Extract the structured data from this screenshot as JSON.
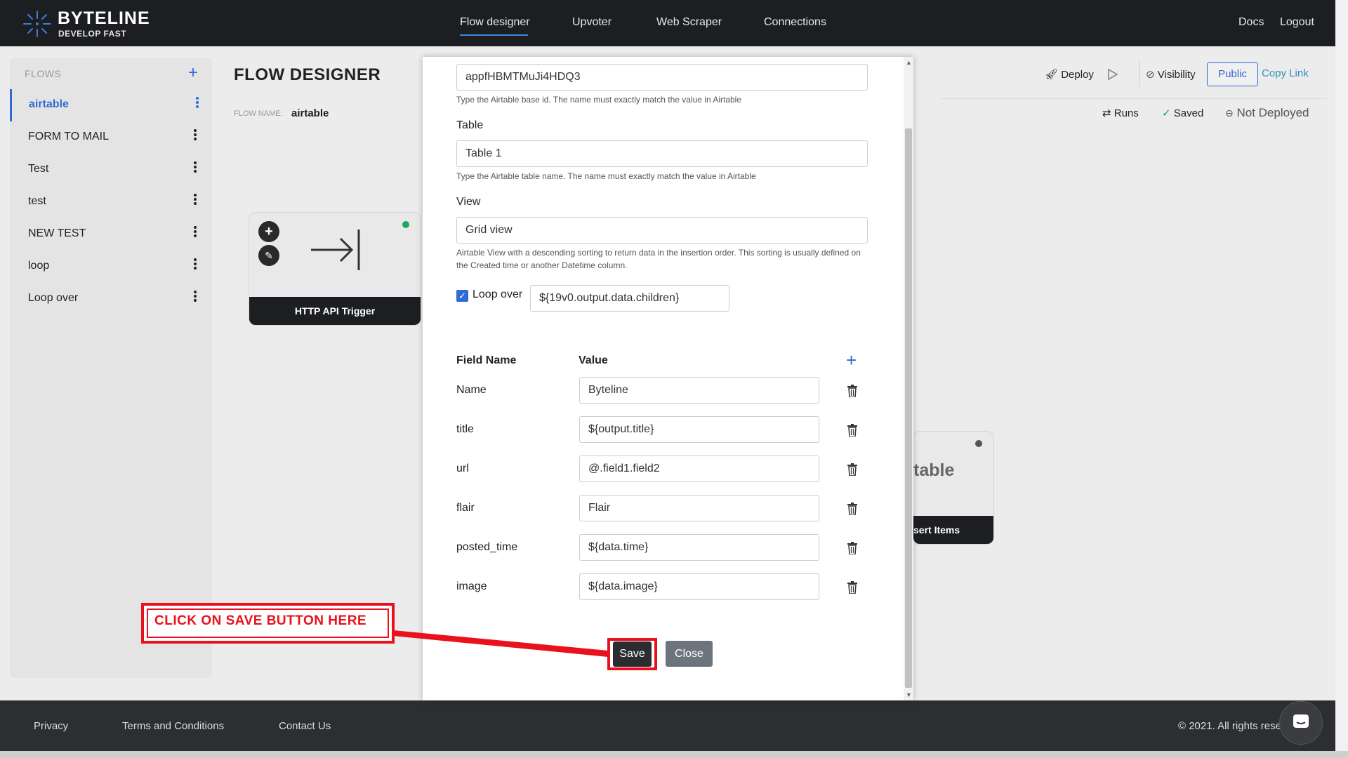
{
  "brand": {
    "name": "BYTELINE",
    "tagline": "DEVELOP FAST"
  },
  "nav": {
    "items": [
      {
        "label": "Flow designer",
        "active": true
      },
      {
        "label": "Upvoter"
      },
      {
        "label": "Web Scraper"
      },
      {
        "label": "Connections"
      }
    ],
    "right": [
      "Docs",
      "Logout"
    ]
  },
  "sidebar": {
    "header": "FLOWS",
    "add_icon": "+",
    "items": [
      {
        "label": "airtable",
        "active": true
      },
      {
        "label": "FORM TO MAIL"
      },
      {
        "label": "Test"
      },
      {
        "label": "test"
      },
      {
        "label": "NEW TEST"
      },
      {
        "label": "loop"
      },
      {
        "label": "Loop over"
      }
    ]
  },
  "main": {
    "title": "FLOW DESIGNER",
    "flow_name_key": "FLOW NAME:",
    "flow_name": "airtable",
    "toolbar": {
      "deploy": "Deploy",
      "visibility": "Visibility",
      "public": "Public",
      "copy_link": "Copy Link",
      "runs": "Runs",
      "saved": "Saved",
      "not_deployed": "Not Deployed"
    },
    "nodes": {
      "trigger": "HTTP API Trigger",
      "airtable_logo": "table",
      "airtable_footer": "sert Items"
    }
  },
  "modal": {
    "base_id": "appfHBMTMuJi4HDQ3",
    "base_help": "Type the Airtable base id. The name must exactly match the value in Airtable",
    "table_label": "Table",
    "table_value": "Table 1",
    "table_help": "Type the Airtable table name. The name must exactly match the value in Airtable",
    "view_label": "View",
    "view_value": "Grid view",
    "view_help": "Airtable View with a descending sorting to return data in the insertion order. This sorting is usually defined on the Created time or another Datetime column.",
    "loop_label": "Loop over",
    "loop_checked": true,
    "loop_value": "${19v0.output.data.children}",
    "field_header": "Field Name",
    "value_header": "Value",
    "rows": [
      {
        "field": "Name",
        "value": "Byteline"
      },
      {
        "field": "title",
        "value": "${output.title}"
      },
      {
        "field": "url",
        "value": "@.field1.field2"
      },
      {
        "field": "flair",
        "value": "Flair"
      },
      {
        "field": "posted_time",
        "value": "${data.time}"
      },
      {
        "field": "image",
        "value": "${data.image}"
      }
    ],
    "save": "Save",
    "close": "Close"
  },
  "annotation": {
    "text": "CLICK ON SAVE BUTTON HERE",
    "color": "#e8111d"
  },
  "footer": {
    "links": [
      "Privacy",
      "Terms and Conditions",
      "Contact Us"
    ],
    "copyright": "© 2021. All rights rese"
  },
  "colors": {
    "accent": "#2f6bd6",
    "nav_bg": "#1c1e21",
    "annotation": "#e8111d"
  }
}
